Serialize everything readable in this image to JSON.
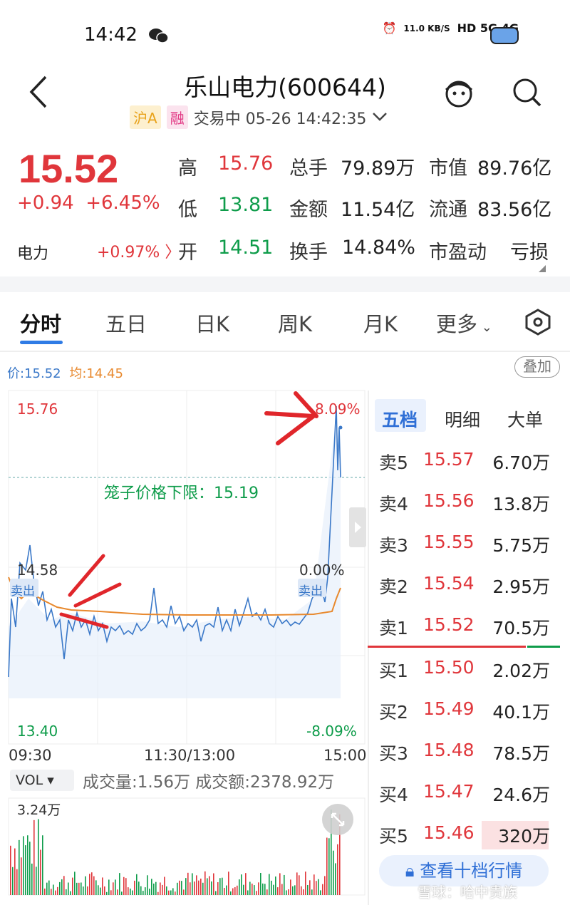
{
  "status_bar": {
    "time": "14:42",
    "net_speed": "11.0 KB/S",
    "signal": "HD 5G 4G"
  },
  "header": {
    "title": "乐山电力(600644)",
    "badge_market": "沪A",
    "badge_margin": "融",
    "trade_status": "交易中 05-26 14:42:35"
  },
  "quote": {
    "price": "15.52",
    "change": "+0.94",
    "change_pct": "+6.45%",
    "sector_name": "电力",
    "sector_change": "+0.97%",
    "fields": [
      {
        "label": "高",
        "value": "15.76",
        "color": "red"
      },
      {
        "label": "总手",
        "value": "79.89万"
      },
      {
        "label": "市值",
        "value": "89.76亿"
      },
      {
        "label": "低",
        "value": "13.81",
        "color": "green"
      },
      {
        "label": "金额",
        "value": "11.54亿"
      },
      {
        "label": "流通",
        "value": "83.56亿"
      },
      {
        "label": "开",
        "value": "14.51",
        "color": "green"
      },
      {
        "label": "换手",
        "value": "14.84%"
      },
      {
        "label": "市盈动",
        "value": "亏损"
      }
    ]
  },
  "tabs": [
    "分时",
    "五日",
    "日K",
    "周K",
    "月K",
    "更多"
  ],
  "chart": {
    "legend_price_label": "价:15.52",
    "legend_avg_label": "均:14.45",
    "stack_button": "叠加",
    "y_top_price": "15.76",
    "y_mid_price": "14.58",
    "y_bottom_price": "13.40",
    "y_top_pct": "8.09%",
    "y_mid_pct": "0.00%",
    "y_bottom_pct": "-8.09%",
    "x_labels": [
      "09:30",
      "11:30/13:00",
      "15:00"
    ],
    "cage_label": "笼子价格下限：",
    "cage_value": "15.19",
    "sell_tag": "卖出",
    "vol_label": "VOL",
    "vol_text": "成交量:1.56万 成交额:2378.92万",
    "vol_max": "3.24万",
    "colors": {
      "price_line": "#3a78c8",
      "avg_line": "#e8892e",
      "up": "#e0363b",
      "down": "#0e9c4a"
    }
  },
  "order_book": {
    "tabs": [
      "五档",
      "明细",
      "大单"
    ],
    "asks": [
      {
        "label": "卖5",
        "price": "15.57",
        "volume": "6.70万"
      },
      {
        "label": "卖4",
        "price": "15.56",
        "volume": "13.8万"
      },
      {
        "label": "卖3",
        "price": "15.55",
        "volume": "5.75万"
      },
      {
        "label": "卖2",
        "price": "15.54",
        "volume": "2.95万"
      },
      {
        "label": "卖1",
        "price": "15.52",
        "volume": "70.5万"
      }
    ],
    "bids": [
      {
        "label": "买1",
        "price": "15.50",
        "volume": "2.02万"
      },
      {
        "label": "买2",
        "price": "15.49",
        "volume": "40.1万"
      },
      {
        "label": "买3",
        "price": "15.48",
        "volume": "78.5万"
      },
      {
        "label": "买4",
        "price": "15.47",
        "volume": "24.6万"
      },
      {
        "label": "买5",
        "price": "15.46",
        "volume": "320万"
      }
    ],
    "ten_level_button": "查看十档行情"
  },
  "watermark": "雪球：哈中贵族"
}
